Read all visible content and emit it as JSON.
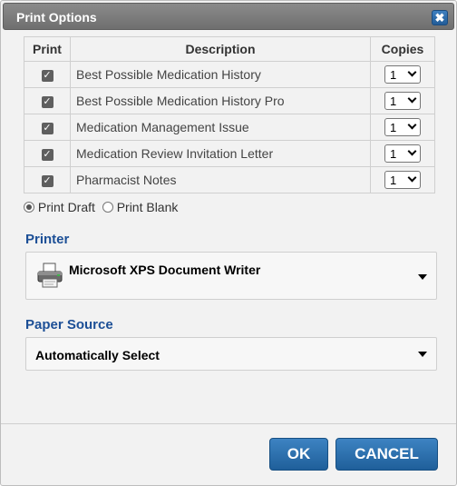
{
  "dialog": {
    "title": "Print Options",
    "close_glyph": "✖"
  },
  "table": {
    "headers": {
      "print": "Print",
      "description": "Description",
      "copies": "Copies"
    },
    "rows": [
      {
        "checked": true,
        "description": "Best Possible Medication History",
        "copies": "1"
      },
      {
        "checked": true,
        "description": "Best Possible Medication History Pro",
        "copies": "1"
      },
      {
        "checked": true,
        "description": "Medication Management Issue",
        "copies": "1"
      },
      {
        "checked": true,
        "description": "Medication Review Invitation Letter",
        "copies": "1"
      },
      {
        "checked": true,
        "description": "Pharmacist Notes",
        "copies": "1"
      }
    ]
  },
  "print_mode": {
    "selected": "draft",
    "draft_label": "Print Draft",
    "blank_label": "Print Blank"
  },
  "printer": {
    "label": "Printer",
    "value": "Microsoft XPS Document Writer",
    "icon": "printer-icon"
  },
  "paper_source": {
    "label": "Paper Source",
    "value": "Automatically Select"
  },
  "buttons": {
    "ok": "OK",
    "cancel": "CANCEL"
  },
  "colors": {
    "accent": "#1c4f96",
    "button": "#2a6dad",
    "titlebar": "#7d7d7d"
  }
}
